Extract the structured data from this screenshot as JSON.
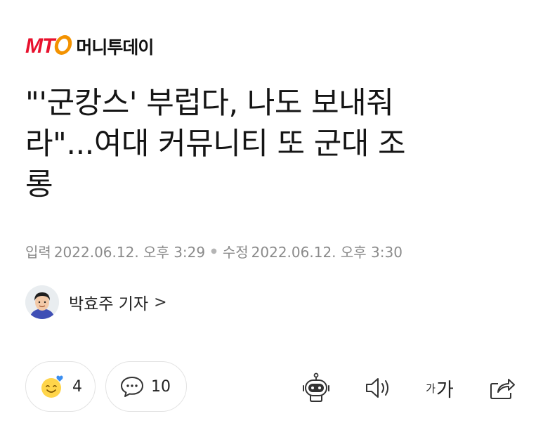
{
  "brand": {
    "logo_text": "MT",
    "name": "머니투데이",
    "colors": {
      "red": "#e8112d",
      "orange": "#f39200"
    }
  },
  "article": {
    "headline_line1": "\"'군캉스' 부럽다, 나도 보내줘",
    "headline_line2": "라\"...여대 커뮤니티 또 군대 조",
    "headline_line3": "롱",
    "input_label": "입력",
    "input_time": "2022.06.12. 오후 3:29",
    "edit_label": "수정",
    "edit_time": "2022.06.12. 오후 3:30"
  },
  "author": {
    "name": "박효주 기자",
    "chevron": ">"
  },
  "reactions": {
    "like_icon": "smiley-heart-icon",
    "like_count": "4",
    "comment_icon": "speech-bubble-icon",
    "comment_count": "10"
  },
  "tools": {
    "summary_icon": "robot-icon",
    "tts_icon": "speaker-icon",
    "font_small": "가",
    "font_big": "가",
    "share_icon": "share-icon"
  }
}
